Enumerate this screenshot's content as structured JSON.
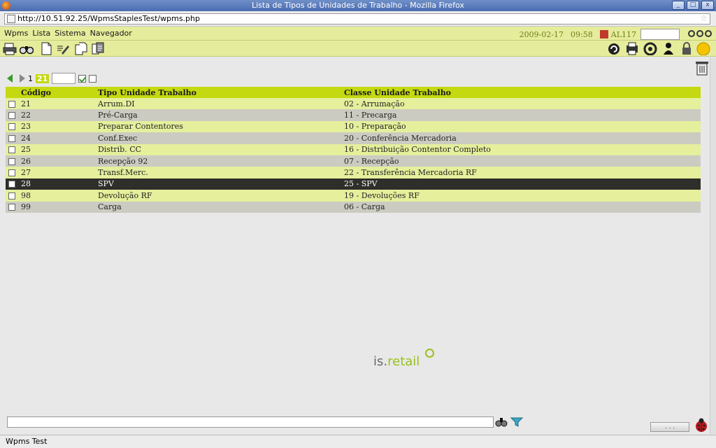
{
  "window": {
    "title": "Lista de Tipos de Unidades de Trabalho - Mozilla Firefox",
    "buttons": [
      "_",
      "□",
      "x"
    ]
  },
  "browser": {
    "url": "http://10.51.92.25/WpmsStaplesTest/wpms.php",
    "status": "Wpms Test"
  },
  "menu": {
    "items": [
      "Wpms",
      "Lista",
      "Sistema",
      "Navegador"
    ]
  },
  "session": {
    "date": "2009-02-17",
    "time": "09:58",
    "user": "AL117"
  },
  "toolbar": {
    "left_icons": [
      "printer-icon",
      "binoculars-icon",
      "new-page-icon",
      "edit-icon",
      "copy-icon",
      "export-icon"
    ],
    "right_icons": [
      "refresh-icon",
      "print-list-icon",
      "settings-icon",
      "user-icon",
      "lock-icon",
      "sun-icon"
    ]
  },
  "pager": {
    "page": "1",
    "count": "21"
  },
  "table": {
    "headers": [
      "Código",
      "Tipo Unidade Trabalho",
      "Classe Unidade Trabalho"
    ],
    "rows": [
      {
        "codigo": "21",
        "tipo": "Arrum.DI",
        "classe": "02 - Arrumação"
      },
      {
        "codigo": "22",
        "tipo": "Pré-Carga",
        "classe": "11 - Precarga"
      },
      {
        "codigo": "23",
        "tipo": "Preparar Contentores",
        "classe": "10 - Preparação"
      },
      {
        "codigo": "24",
        "tipo": "Conf.Exec",
        "classe": "20 - Conferência Mercadoria"
      },
      {
        "codigo": "25",
        "tipo": "Distrib. CC",
        "classe": "16 - Distribuição Contentor Completo"
      },
      {
        "codigo": "26",
        "tipo": "Recepção 92",
        "classe": "07 - Recepção"
      },
      {
        "codigo": "27",
        "tipo": "Transf.Merc.",
        "classe": "22 - Transferência Mercadoria RF"
      },
      {
        "codigo": "28",
        "tipo": "SPV",
        "classe": "25 - SPV"
      },
      {
        "codigo": "98",
        "tipo": "Devolução RF",
        "classe": "19 - Devoluções RF"
      },
      {
        "codigo": "99",
        "tipo": "Carga",
        "classe": "06 - Carga"
      }
    ],
    "selected_index": 7
  },
  "logo": {
    "prefix": "is.",
    "suffix": "retail"
  },
  "footer": {
    "dots_button": ". . ."
  },
  "colors": {
    "accent": "#c4d90f",
    "row_light": "#e5ef9c",
    "row_gray": "#cbcbc2",
    "selected": "#2e2e2a"
  }
}
